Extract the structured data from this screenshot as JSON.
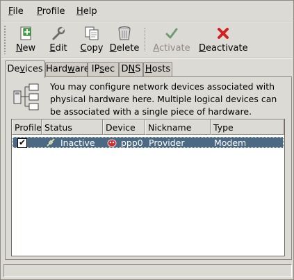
{
  "menu": {
    "items": [
      {
        "label": "File",
        "mnemonic": "F"
      },
      {
        "label": "Profile",
        "mnemonic": "P"
      },
      {
        "label": "Help",
        "mnemonic": "H"
      }
    ]
  },
  "toolbar": {
    "new_label": "New",
    "edit_label": "Edit",
    "copy_label": "Copy",
    "delete_label": "Delete",
    "activate_label": "Activate",
    "deactivate_label": "Deactivate"
  },
  "tabs": [
    {
      "label": "Devices",
      "active": true
    },
    {
      "label": "Hardware",
      "active": false
    },
    {
      "label": "IPsec",
      "active": false
    },
    {
      "label": "DNS",
      "active": false
    },
    {
      "label": "Hosts",
      "active": false
    }
  ],
  "info": {
    "text": "You may configure network devices associated with physical hardware here.  Multiple logical devices can be associated with a single piece of hardware."
  },
  "table": {
    "columns": [
      "Profile",
      "Status",
      "Device",
      "Nickname",
      "Type"
    ],
    "rows": [
      {
        "profile_checked": true,
        "status": "Inactive",
        "device": "ppp0",
        "nickname": "Provider",
        "type": "Modem"
      }
    ]
  },
  "colors": {
    "selection": "#4b6983",
    "window_bg": "#dcdad5",
    "delete_red": "#d22020",
    "activate_green": "#3a8a3a"
  }
}
